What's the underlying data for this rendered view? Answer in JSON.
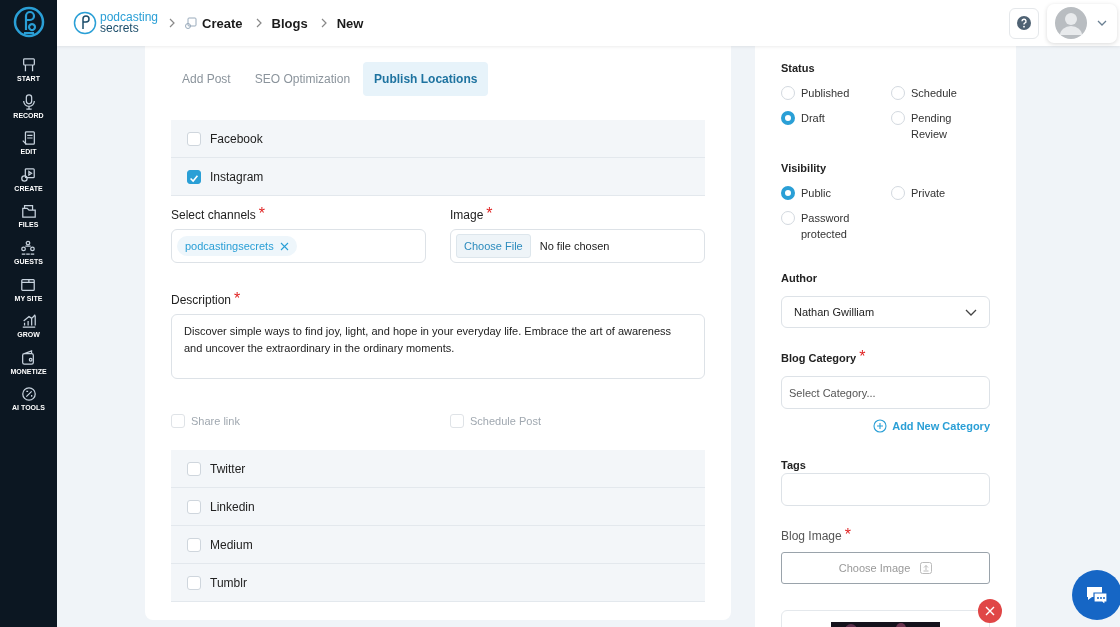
{
  "sidebar": {
    "items": [
      {
        "label": "START"
      },
      {
        "label": "RECORD"
      },
      {
        "label": "EDIT"
      },
      {
        "label": "CREATE"
      },
      {
        "label": "FILES"
      },
      {
        "label": "GUESTS"
      },
      {
        "label": "MY SITE"
      },
      {
        "label": "GROW"
      },
      {
        "label": "MONETIZE"
      },
      {
        "label": "AI TOOLS"
      }
    ]
  },
  "topbar": {
    "logo": {
      "line_1": "podcasting",
      "line_2": "secrets"
    },
    "breadcrumb": [
      "Create",
      "Blogs",
      "New"
    ]
  },
  "tabs": [
    {
      "label": "Add Post",
      "selected": false
    },
    {
      "label": "SEO Optimization",
      "selected": false
    },
    {
      "label": "Publish Locations",
      "selected": true
    }
  ],
  "locations_top": [
    {
      "label": "Facebook",
      "checked": false
    },
    {
      "label": "Instagram",
      "checked": true
    }
  ],
  "channels": {
    "label": "Select channels",
    "required": "*",
    "chips": [
      "podcastingsecrets"
    ]
  },
  "image": {
    "label": "Image",
    "required": "*",
    "button": "Choose File",
    "file_text": "No file chosen"
  },
  "description": {
    "label": "Description",
    "required": "*",
    "value": "Discover simple ways to find joy, light, and hope in your everyday life. Embrace the art of awareness and uncover the extraordinary in the ordinary moments."
  },
  "options": [
    {
      "label": "Share link",
      "checked": false,
      "disabled": true
    },
    {
      "label": "Schedule Post",
      "checked": false,
      "disabled": true
    }
  ],
  "locations_bottom": [
    {
      "label": "Twitter",
      "checked": false
    },
    {
      "label": "Linkedin",
      "checked": false
    },
    {
      "label": "Medium",
      "checked": false
    },
    {
      "label": "Tumblr",
      "checked": false
    }
  ],
  "status": {
    "label": "Status",
    "options": [
      {
        "label": "Published",
        "selected": false
      },
      {
        "label": "Schedule",
        "selected": false
      },
      {
        "label": "Draft",
        "selected": true
      },
      {
        "label": "Pending Review",
        "selected": false
      }
    ]
  },
  "visibility": {
    "label": "Visibility",
    "options": [
      {
        "label": "Public",
        "selected": true
      },
      {
        "label": "Private",
        "selected": false
      },
      {
        "label": "Password protected",
        "selected": false
      }
    ]
  },
  "author": {
    "label": "Author",
    "value": "Nathan Gwilliam"
  },
  "category": {
    "label": "Blog Category",
    "required": "*",
    "placeholder": "Select Category...",
    "add_link": "Add New Category"
  },
  "tags": {
    "label": "Tags"
  },
  "blog_image": {
    "label": "Blog Image",
    "required": "*",
    "button": "Choose Image"
  }
}
